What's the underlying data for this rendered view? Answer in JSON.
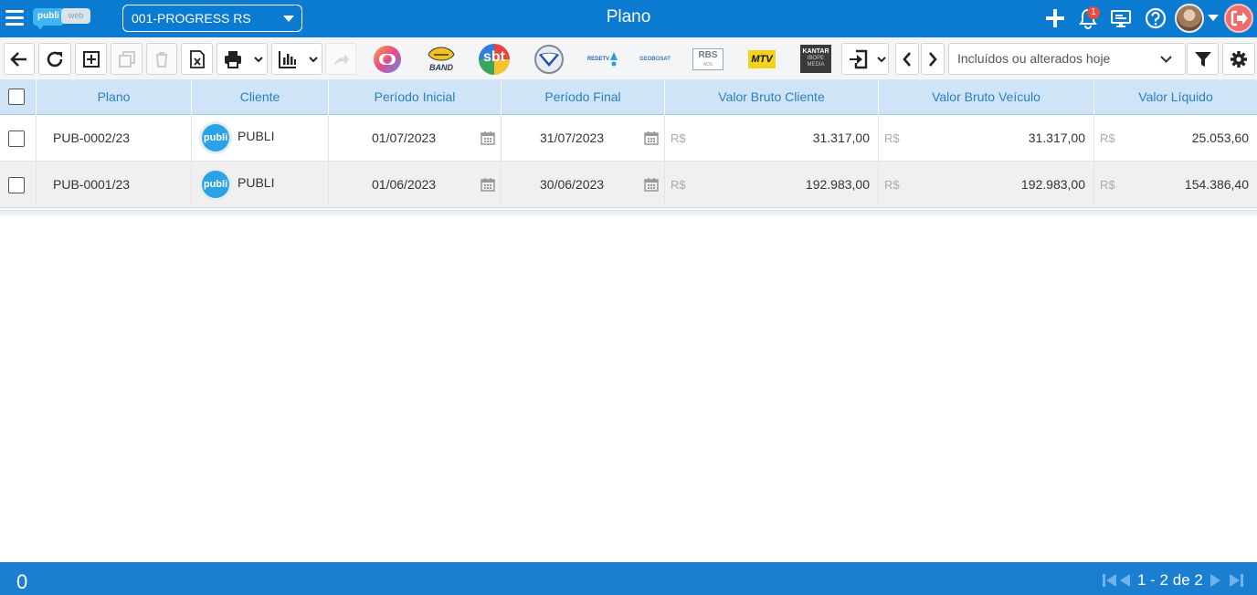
{
  "app": {
    "logo_text_1": "publi",
    "logo_text_2": "web",
    "company_selected": "001-PROGRESS RS",
    "page_title": "Plano",
    "notifications_count": "1"
  },
  "toolbar": {
    "channels": [
      "Globo",
      "Band",
      "SBT",
      "Record",
      "RedeTV",
      "Geobosat",
      "RBS",
      "MTV",
      "Kantar"
    ],
    "channel_texts": {
      "band": "BAND",
      "sbt": "sbt",
      "redetv": "REDETV",
      "geobosat": "GEOBOSAT",
      "rbs": "RBS",
      "rbs_sub": "ADS",
      "mtv": "MTV",
      "kantar": "KANTAR",
      "kantar_sub1": "IBOPE",
      "kantar_sub2": "MEDIA"
    },
    "filter_value": "Incluídos ou alterados hoje"
  },
  "table": {
    "columns": [
      "Plano",
      "Cliente",
      "Período Inicial",
      "Período Final",
      "Valor Bruto Cliente",
      "Valor Bruto Veículo",
      "Valor Líquido"
    ],
    "currency": "R$",
    "client_logo_text": "publi",
    "rows": [
      {
        "plano": "PUB-0002/23",
        "cliente": "PUBLI",
        "inicio": "01/07/2023",
        "fim": "31/07/2023",
        "bruto_cliente": "31.317,00",
        "bruto_veiculo": "31.317,00",
        "liquido": "25.053,60"
      },
      {
        "plano": "PUB-0001/23",
        "cliente": "PUBLI",
        "inicio": "01/06/2023",
        "fim": "30/06/2023",
        "bruto_cliente": "192.983,00",
        "bruto_veiculo": "192.983,00",
        "liquido": "154.386,40"
      }
    ]
  },
  "footer": {
    "selected_count": "0",
    "pager_text": "1 - 2 de 2"
  },
  "colors": {
    "topbar": "#0a7bd1",
    "header_bg": "#cfe4f6",
    "header_text": "#2a7fc1",
    "footer": "#1b7fd1",
    "logout": "#ef6a6a"
  }
}
